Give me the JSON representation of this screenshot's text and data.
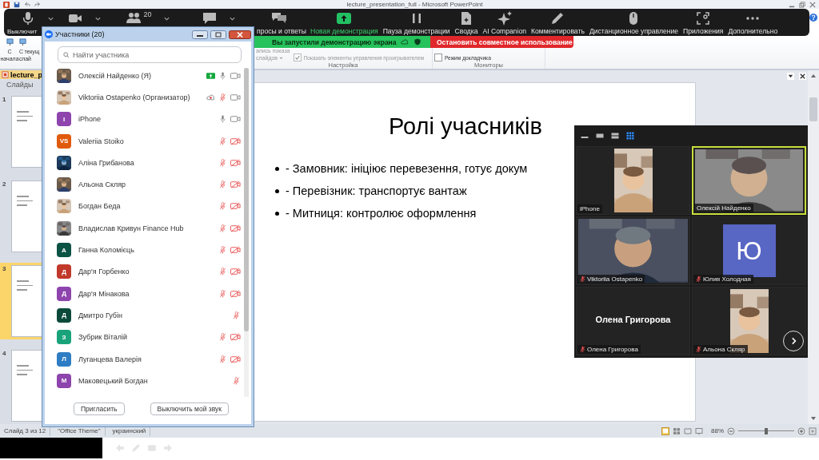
{
  "powerpoint": {
    "title": "lecture_presentation_full - Microsoft PowerPoint",
    "ribbon": {
      "start_buttons": [
        {
          "line1": "С",
          "line2": "начала"
        },
        {
          "line1": "С текущ",
          "line2": "слай"
        }
      ],
      "record": {
        "line1": "апись показа",
        "line2": "слайдов"
      },
      "groups": [
        {
          "label": "Настройка",
          "checkboxes": [
            {
              "label": "Показать элементы управления проигрывателем",
              "checked": true,
              "disabled": true
            }
          ]
        },
        {
          "label": "Мониторы",
          "checkboxes": [
            {
              "label": "Режим докладчика",
              "checked": false,
              "disabled": false
            }
          ]
        }
      ]
    },
    "document_tab": "lecture_p",
    "pane_tab": "Слайды",
    "slides": [
      {
        "number": "1",
        "selected": false
      },
      {
        "number": "2",
        "selected": false
      },
      {
        "number": "3",
        "selected": true
      },
      {
        "number": "4",
        "selected": false
      }
    ],
    "slide": {
      "title": "Ролі учасників",
      "bullets": [
        "- Замовник: ініціює перевезення, готує докум",
        "- Перевізник: транспортує вантаж",
        "- Митниця: контролює оформлення"
      ]
    },
    "status_bar": {
      "slide": "Слайд 3 из 12",
      "theme": "\"Office Theme\"",
      "language": "украинский",
      "zoom": "88%",
      "zoom_slider": {
        "level": 0.5
      }
    }
  },
  "zoom_toolbar": {
    "items": [
      {
        "kind": "mic",
        "label": "Выключит"
      },
      {
        "kind": "video"
      },
      {
        "kind": "participants",
        "count": "20"
      },
      {
        "kind": "chat"
      },
      {
        "kind": "qa",
        "label": "просы и ответы"
      },
      {
        "kind": "share",
        "label": "Новая демонстрация"
      },
      {
        "kind": "pause",
        "label": "Пауза демонстрации"
      },
      {
        "kind": "summary",
        "label": "Сводка"
      },
      {
        "kind": "ai",
        "label": "AI Companion"
      },
      {
        "kind": "annotate",
        "label": "Комментировать"
      },
      {
        "kind": "remote",
        "label": "Дистанционное управление"
      },
      {
        "kind": "apps",
        "label": "Приложения"
      },
      {
        "kind": "more",
        "label": "Дополнительно"
      }
    ]
  },
  "sharing_banner": {
    "status": "Вы запустили демонстрацию экрана",
    "stop": "Остановить совместное использование"
  },
  "participants_window": {
    "title": "Участники (20)",
    "search": {
      "placeholder": "Найти участника"
    },
    "participants": [
      {
        "name": "Олексій Найденко (Я)",
        "sharing": true,
        "recording": false,
        "muted": false,
        "video_off": false
      },
      {
        "name": "Viktoriia Ostapenko (Организатор)",
        "sharing": false,
        "recording": true,
        "muted": true,
        "video_off": false
      },
      {
        "name": "iPhone",
        "kind": "initials",
        "initials": "I",
        "color": "#8e44ad",
        "sharing": false,
        "recording": false,
        "muted": false,
        "video_off": false
      },
      {
        "name": "Valeriia Stoiko",
        "kind": "initials",
        "initials": "VS",
        "color": "#e05a0c",
        "sharing": false,
        "recording": false,
        "muted": true,
        "video_off": true
      },
      {
        "name": "Аліна Грибанова",
        "sharing": false,
        "recording": false,
        "muted": true,
        "video_off": true
      },
      {
        "name": "Альона Скляр",
        "sharing": false,
        "recording": false,
        "muted": true,
        "video_off": true
      },
      {
        "name": "Богдан Беда",
        "sharing": false,
        "recording": false,
        "muted": true,
        "video_off": true
      },
      {
        "name": "Владислав Кривун Finance Hub",
        "sharing": false,
        "recording": false,
        "muted": true,
        "video_off": true
      },
      {
        "name": "Ганна Коломієць",
        "kind": "initials",
        "initials": "А",
        "color": "#0b5345",
        "sharing": false,
        "recording": false,
        "muted": true,
        "video_off": true
      },
      {
        "name": "Дар'я Горбенко",
        "kind": "initials",
        "initials": "Д",
        "color": "#c0392b",
        "sharing": false,
        "recording": false,
        "muted": true,
        "video_off": true
      },
      {
        "name": "Дар'я Мінакова",
        "kind": "initials",
        "initials": "Д",
        "color": "#8e44ad",
        "sharing": false,
        "recording": false,
        "muted": true,
        "video_off": true
      },
      {
        "name": "Дмитро Губін",
        "kind": "initials",
        "initials": "Д",
        "color": "#0b4a3a",
        "sharing": false,
        "recording": false,
        "muted": true
      },
      {
        "name": "Зубрик Віталій",
        "kind": "initials",
        "initials": "З",
        "color": "#1aa37a",
        "sharing": false,
        "recording": false,
        "muted": true,
        "video_off": true
      },
      {
        "name": "Луганцева Валерія",
        "kind": "initials",
        "initials": "Л",
        "color": "#2e7dc4",
        "sharing": false,
        "recording": false,
        "muted": true,
        "video_off": true
      },
      {
        "name": "Маковецький Богдан",
        "kind": "initials",
        "initials": "М",
        "color": "#8e44ad",
        "sharing": false,
        "recording": false,
        "muted": true
      }
    ],
    "buttons": [
      "Пригласить",
      "Выключить мой звук"
    ]
  },
  "gallery": {
    "view_buttons": [
      {
        "kind": "minimize",
        "selected": false
      },
      {
        "kind": "speaker",
        "selected": false
      },
      {
        "kind": "strip",
        "selected": false
      },
      {
        "kind": "grid",
        "selected": true
      }
    ],
    "tiles": [
      {
        "kind": "portrait-video",
        "name": "iPhone",
        "muted": false,
        "speaking": false
      },
      {
        "kind": "video",
        "name": "Олексій Найденко",
        "muted": false,
        "speaking": true
      },
      {
        "kind": "video",
        "name": "Viktoriia Ostapenko",
        "muted": true,
        "speaking": false
      },
      {
        "kind": "avatar",
        "initial": "Ю",
        "name": "Юлия Холодная",
        "muted": true,
        "speaking": false
      },
      {
        "kind": "name",
        "display_name": "Олена Григорова",
        "name": "Олена Григорова",
        "muted": true,
        "speaking": false
      },
      {
        "kind": "portrait-video",
        "name": "Альона Скляр",
        "muted": true,
        "speaking": false
      }
    ]
  }
}
